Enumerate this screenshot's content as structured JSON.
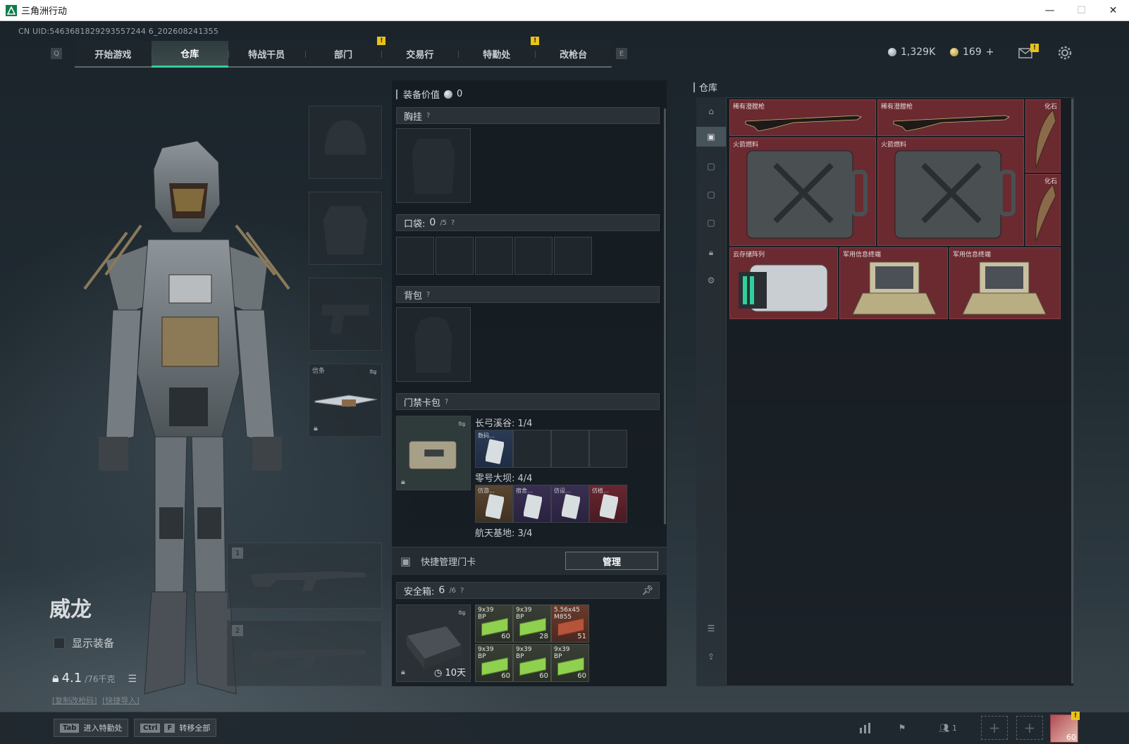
{
  "window": {
    "title": "三角洲行动",
    "minimize": "—",
    "maximize": "☐",
    "close": "✕"
  },
  "uid": "CN UID:5463681829293557244 6_202608241355",
  "nav": {
    "left_key": "Q",
    "right_key": "E",
    "tabs": [
      {
        "label": "开始游戏",
        "active": false
      },
      {
        "label": "仓库",
        "active": true
      },
      {
        "label": "特战干员",
        "active": false
      },
      {
        "label": "部门",
        "active": false,
        "notice": "!"
      },
      {
        "label": "交易行",
        "active": false
      },
      {
        "label": "特勤处",
        "active": false,
        "notice": "!"
      },
      {
        "label": "改枪台",
        "active": false
      }
    ]
  },
  "currency": {
    "silver": "1,329K",
    "gold": "169",
    "add": "+"
  },
  "character": {
    "name": "威龙",
    "show_equipment": "显示装备",
    "weight_value": "4.1",
    "weight_max": "/76千克",
    "link_copy": "[复制改枪码]",
    "link_import": "[快捷导入]",
    "melee_label": "信条",
    "weapon_slot_1": "1",
    "weapon_slot_2": "2"
  },
  "equipment": {
    "value_label": "装备价值",
    "value": "0",
    "chest_rig": "胸挂",
    "pocket_label": "口袋:",
    "pocket_used": "0",
    "pocket_max": "/5",
    "backpack": "背包",
    "keycard_label": "门禁卡包",
    "help": "?",
    "maps": [
      {
        "name": "长弓溪谷:",
        "count": "1/4",
        "cards": [
          {
            "tag": "数码…",
            "color": "blue"
          },
          {
            "tag": "",
            "color": "empty"
          },
          {
            "tag": "",
            "color": "empty"
          },
          {
            "tag": "",
            "color": "empty"
          }
        ]
      },
      {
        "name": "零号大坝:",
        "count": "4/4",
        "cards": [
          {
            "tag": "仿游…",
            "color": "brown"
          },
          {
            "tag": "宿舍…",
            "color": "purple"
          },
          {
            "tag": "仿设…",
            "color": "purple"
          },
          {
            "tag": "仿植…",
            "color": "red"
          }
        ]
      },
      {
        "name": "航天基地:",
        "count": "3/4"
      }
    ],
    "quick_manage": "快捷管理门卡",
    "manage_button": "管理",
    "safe_box_label": "安全箱:",
    "safe_box_used": "6",
    "safe_box_max": "/6",
    "safe_box_timer": "10天",
    "ammo": [
      {
        "tag": "9x39\nBP",
        "count": "60",
        "type": "green"
      },
      {
        "tag": "9x39\nBP",
        "count": "28",
        "type": "green"
      },
      {
        "tag": "5.56x45\nM855",
        "count": "51",
        "type": "rust"
      },
      {
        "tag": "9x39\nBP",
        "count": "60",
        "type": "green"
      },
      {
        "tag": "9x39\nBP",
        "count": "60",
        "type": "green"
      },
      {
        "tag": "9x39\nBP",
        "count": "60",
        "type": "green"
      }
    ]
  },
  "warehouse": {
    "title": "仓库",
    "items": [
      {
        "label": "稀有澄膛枪",
        "kind": "rifle"
      },
      {
        "label": "稀有澄膛枪",
        "kind": "rifle"
      },
      {
        "label": "化石",
        "kind": "fossil"
      },
      {
        "label": "火箭燃料",
        "kind": "jerrycan"
      },
      {
        "label": "火箭燃料",
        "kind": "jerrycan"
      },
      {
        "label": "化石",
        "kind": "fossil"
      },
      {
        "label": "云存储阵列",
        "kind": "server"
      },
      {
        "label": "军用信息终端",
        "kind": "terminal"
      },
      {
        "label": "军用信息终端",
        "kind": "terminal"
      }
    ]
  },
  "bottom": {
    "tab_key": "Tab",
    "tab_action": "进入特勤处",
    "ctrl_key": "Ctrl",
    "f_key": "F",
    "ctrl_action": "转移全部",
    "team_count": "1",
    "avatar_level": "60"
  },
  "colors": {
    "accent": "#2fd19a",
    "item_red": "#6a2a30",
    "notice": "#e9c21a"
  }
}
